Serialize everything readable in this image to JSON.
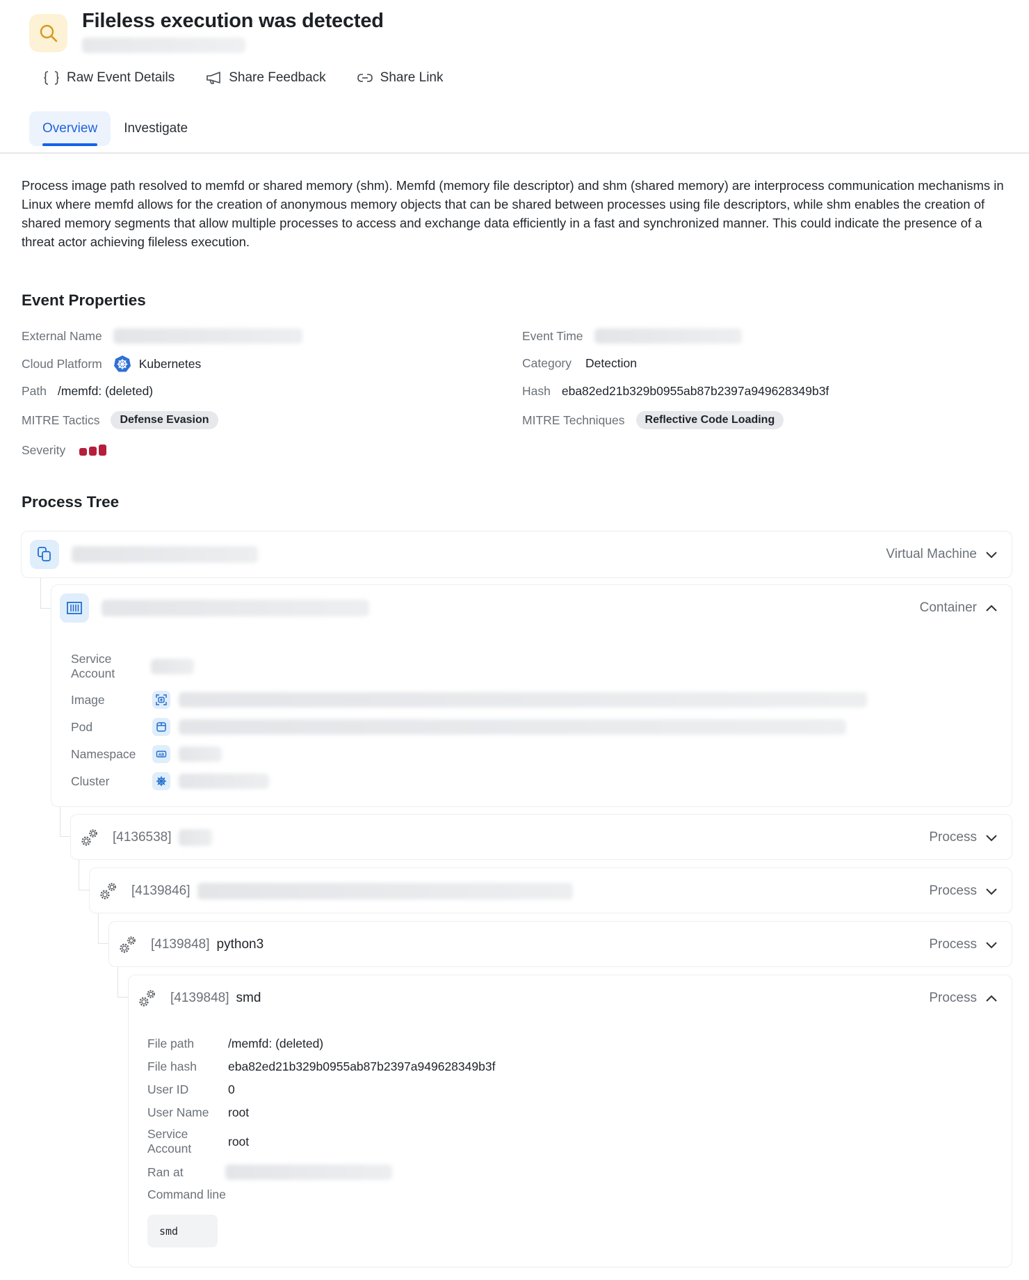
{
  "header": {
    "icon": "search-icon",
    "title": "Fileless execution was detected",
    "subtitle_redacted": true
  },
  "toolbar": {
    "raw_event_details": "Raw Event Details",
    "share_feedback": "Share Feedback",
    "share_link": "Share Link"
  },
  "tabs": [
    {
      "label": "Overview",
      "active": true
    },
    {
      "label": "Investigate",
      "active": false
    }
  ],
  "description": "Process image path resolved to memfd or shared memory (shm). Memfd (memory file descriptor) and shm (shared memory) are interprocess communication mechanisms in Linux where memfd allows for the creation of anonymous memory objects that can be shared between processes using file descriptors, while shm enables the creation of shared memory segments that allow multiple processes to access and exchange data efficiently in a fast and synchronized manner. This could indicate the presence of a threat actor achieving fileless execution.",
  "event_properties": {
    "heading": "Event Properties",
    "external_name": {
      "label": "External Name",
      "value_redacted": true
    },
    "cloud_platform": {
      "label": "Cloud Platform",
      "value": "Kubernetes",
      "icon": "kubernetes-icon"
    },
    "path": {
      "label": "Path",
      "value": "/memfd: (deleted)"
    },
    "mitre_tactics": {
      "label": "MITRE Tactics",
      "value": "Defense Evasion"
    },
    "severity": {
      "label": "Severity",
      "level": 3,
      "max": 3,
      "color": "#b41f3c"
    },
    "event_time": {
      "label": "Event Time",
      "value_redacted": true
    },
    "category": {
      "label": "Category",
      "value": "Detection"
    },
    "hash": {
      "label": "Hash",
      "value": "eba82ed21b329b0955ab87b2397a949628349b3f"
    },
    "mitre_techniques": {
      "label": "MITRE Techniques",
      "value": "Reflective Code Loading"
    }
  },
  "process_tree": {
    "heading": "Process Tree",
    "vm": {
      "kind": "Virtual Machine",
      "expanded": false,
      "name_redacted": true
    },
    "container": {
      "kind": "Container",
      "expanded": true,
      "name_redacted": true,
      "fields": {
        "service_account": "Service Account",
        "image": "Image",
        "pod": "Pod",
        "namespace": "Namespace",
        "cluster": "Cluster"
      }
    },
    "processes": [
      {
        "pid": "[4136538]",
        "name": "",
        "name_redacted": true,
        "kind": "Process",
        "expanded": false
      },
      {
        "pid": "[4139846]",
        "name": "",
        "name_redacted": true,
        "kind": "Process",
        "expanded": false
      },
      {
        "pid": "[4139848]",
        "name": "python3",
        "kind": "Process",
        "expanded": false
      },
      {
        "pid": "[4139848]",
        "name": "smd",
        "kind": "Process",
        "expanded": true
      }
    ],
    "process_details": {
      "file_path": {
        "label": "File path",
        "value": "/memfd: (deleted)"
      },
      "file_hash": {
        "label": "File hash",
        "value": "eba82ed21b329b0955ab87b2397a949628349b3f"
      },
      "user_id": {
        "label": "User ID",
        "value": "0"
      },
      "user_name": {
        "label": "User Name",
        "value": "root"
      },
      "service_account": {
        "label": "Service Account",
        "value": "root"
      },
      "ran_at": {
        "label": "Ran at",
        "value_redacted": true
      },
      "command_line": {
        "label": "Command line",
        "value": "smd"
      }
    }
  }
}
